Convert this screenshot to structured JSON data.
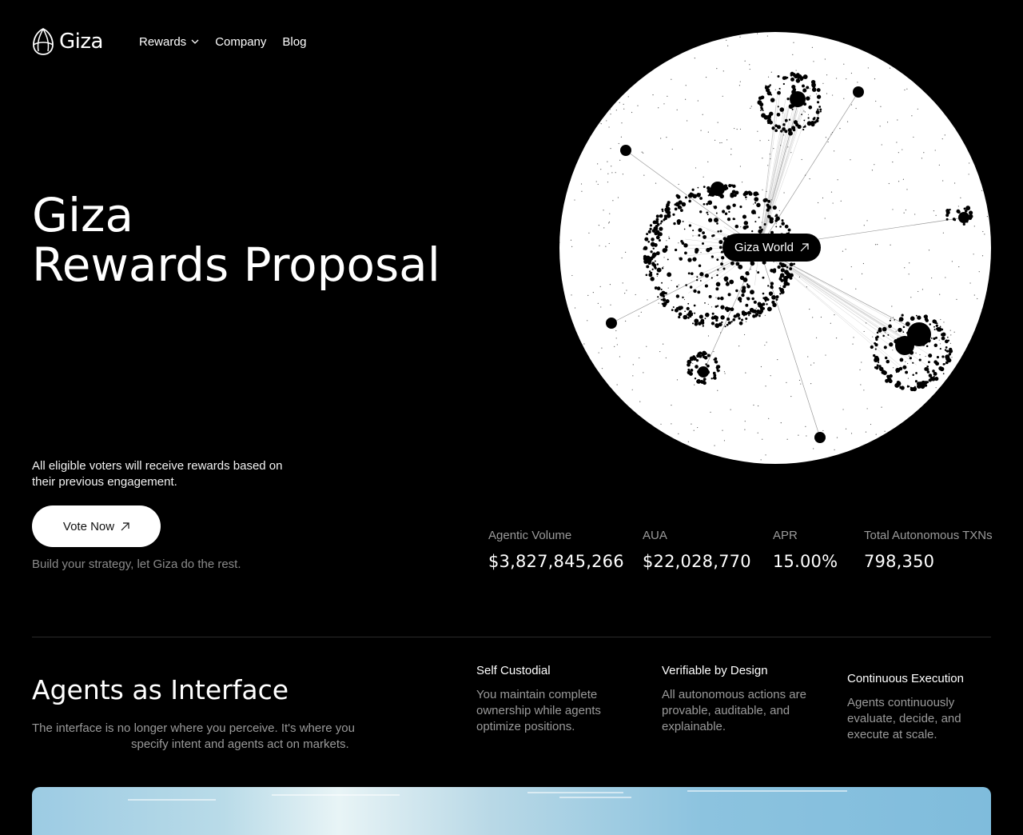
{
  "header": {
    "brand": "Giza",
    "nav": [
      {
        "label": "Rewards",
        "has_dropdown": true
      },
      {
        "label": "Company"
      },
      {
        "label": "Blog"
      }
    ]
  },
  "hero": {
    "title_line1": "Giza",
    "title_line2": "Rewards Proposal",
    "subtitle": "All eligible voters will receive rewards based on their previous engagement.",
    "vote_button": "Vote Now",
    "build_text": "Build your strategy, let Giza do the rest.",
    "world_button": "Giza World"
  },
  "stats": [
    {
      "label": "Agentic Volume",
      "value": "$3,827,845,266"
    },
    {
      "label": "AUA",
      "value": "$22,028,770"
    },
    {
      "label": "APR",
      "value": "15.00%"
    },
    {
      "label": "Total Autonomous TXNs",
      "value": "798,350"
    }
  ],
  "agents": {
    "title": "Agents as Interface",
    "desc_line1": "The interface is no longer where you perceive. It's where you",
    "desc_line2": "specify intent and agents act on markets.",
    "features": [
      {
        "title": "Self Custodial",
        "text": "You maintain complete ownership while agents optimize positions."
      },
      {
        "title": "Verifiable by Design",
        "text": "All autonomous actions are provable, auditable, and explainable."
      },
      {
        "title": "Continuous Execution",
        "text": "Agents continuously evaluate, decide, and execute at scale."
      }
    ]
  },
  "icons": {
    "logo": "giza-logo-icon",
    "dropdown": "chevron-down-icon",
    "arrow": "arrow-up-right-icon"
  },
  "colors": {
    "background": "#000000",
    "muted_text": "#9a9a9a",
    "button_bg": "#ffffff"
  }
}
